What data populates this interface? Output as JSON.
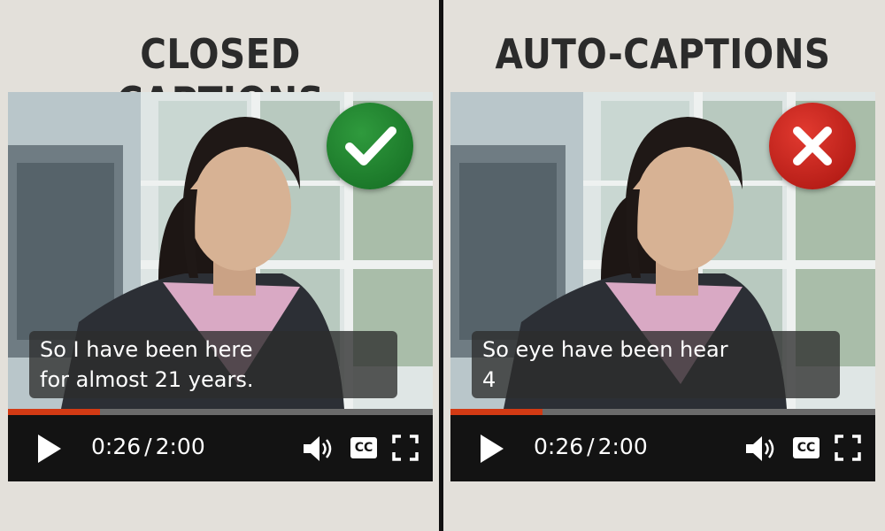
{
  "left": {
    "heading": "CLOSED CAPTIONS",
    "status_icon": "checkmark-icon",
    "status_color": "#1f8a2e",
    "caption_lines": [
      "So I have been here",
      "for almost 21 years."
    ],
    "current_time": "0:26",
    "separator": "/",
    "duration": "2:00",
    "progress_fraction": 0.217
  },
  "right": {
    "heading": "AUTO-CAPTIONS",
    "status_icon": "cross-icon",
    "status_color": "#d0231b",
    "caption_lines": [
      "So eye have been hear",
      "4"
    ],
    "current_time": "0:26",
    "separator": "/",
    "duration": "2:00",
    "progress_fraction": 0.217
  },
  "controls": {
    "play_icon": "play-icon",
    "volume_icon": "volume-icon",
    "cc_label": "CC",
    "fullscreen_icon": "fullscreen-icon"
  },
  "colors": {
    "background": "#e3e0da",
    "progress": "#d23a14",
    "controls_bg": "#131313"
  }
}
